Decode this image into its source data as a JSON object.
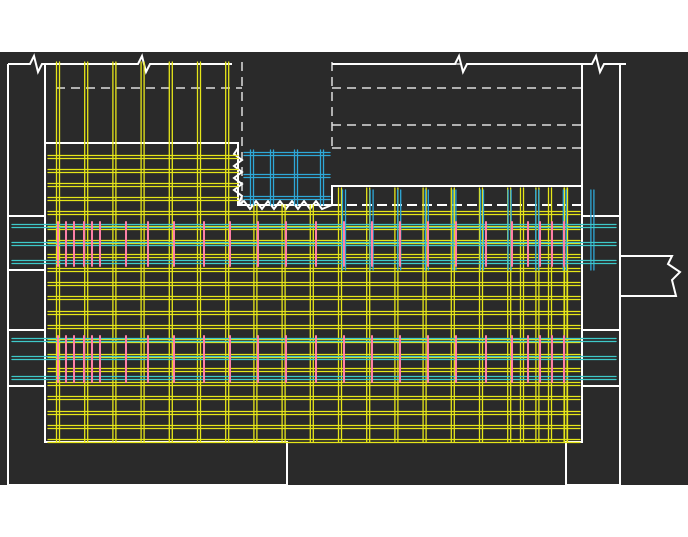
{
  "drawing": {
    "background": "#2a2a2a",
    "colors": {
      "outline": "#ffffff",
      "rebar_main": "#e6e619",
      "rebar_secondary": "#2ea8d8",
      "anchor_bars": "#3ec9c9",
      "stirrups": "#ff7fa6",
      "hidden_line": "#dcdcdc"
    },
    "layers": [
      "concrete-outline",
      "hidden-lines",
      "break-symbols",
      "reinforcement-grid",
      "secondary-reinforcement",
      "anchor-bars",
      "stirrups"
    ],
    "text_labels": []
  }
}
